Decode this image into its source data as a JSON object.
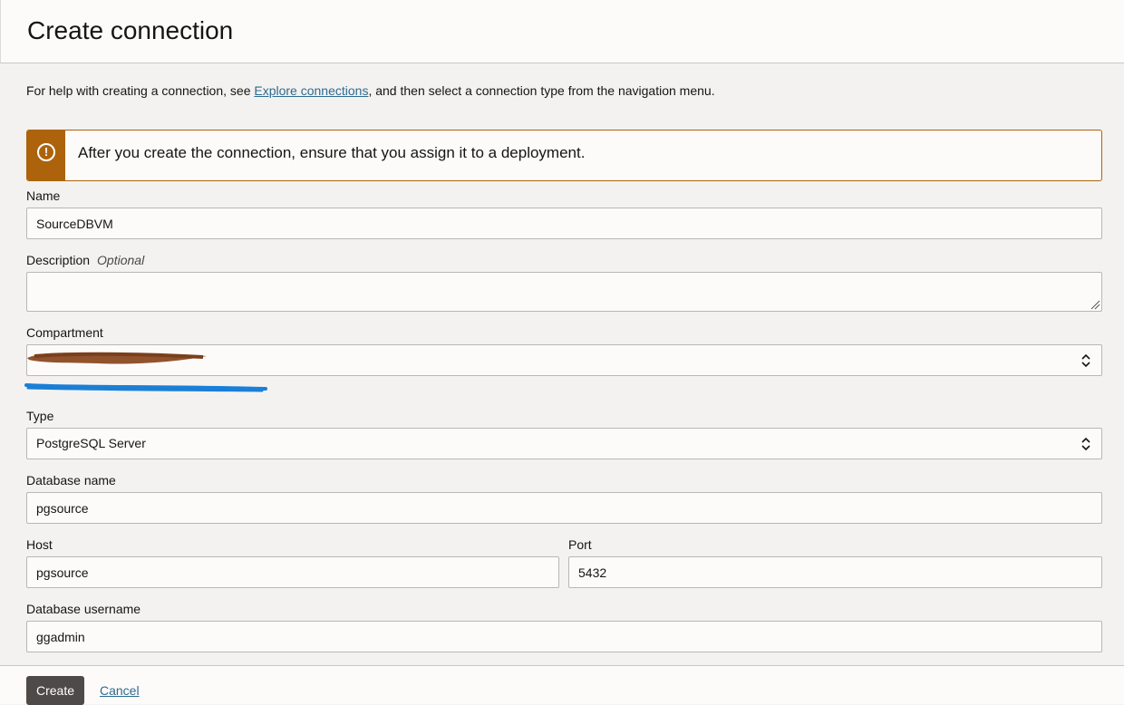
{
  "header": {
    "title": "Create connection"
  },
  "help": {
    "prefix": "For help with creating a connection, see ",
    "link": "Explore connections",
    "suffix": ", and then select a connection type from the navigation menu."
  },
  "banner": {
    "icon": "warning-icon",
    "message": "After you create the connection, ensure that you assign it to a deployment."
  },
  "form": {
    "name": {
      "label": "Name",
      "value": "SourceDBVM"
    },
    "description": {
      "label": "Description",
      "optional": "Optional",
      "value": ""
    },
    "compartment": {
      "label": "Compartment",
      "value": ""
    },
    "type": {
      "label": "Type",
      "value": "PostgreSQL Server"
    },
    "database_name": {
      "label": "Database name",
      "value": "pgsource"
    },
    "host": {
      "label": "Host",
      "value": "pgsource"
    },
    "port": {
      "label": "Port",
      "value": "5432"
    },
    "database_username": {
      "label": "Database username",
      "value": "ggadmin"
    }
  },
  "footer": {
    "create_label": "Create",
    "cancel_label": "Cancel"
  },
  "colors": {
    "warning": "#ac630c",
    "link": "#2e6b8f",
    "primary_button": "#4d4a47",
    "redaction_brown": "#8b4a22",
    "redaction_blue": "#1a7fd6"
  }
}
